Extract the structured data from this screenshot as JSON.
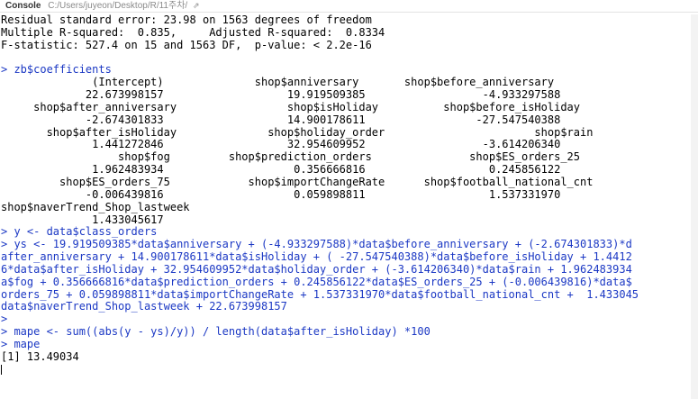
{
  "header": {
    "title": "Console",
    "path": "C:/Users/juyeon/Desktop/R/11주차/",
    "goto_icon": "arrow-right-icon",
    "goto_glyph": "⇗"
  },
  "colors": {
    "command": "#1b38c4",
    "output": "#000000",
    "background": "#ffffff"
  },
  "lines": [
    {
      "kind": "out",
      "text": "Residual standard error: 23.98 on 1563 degrees of freedom"
    },
    {
      "kind": "out",
      "text": "Multiple R-squared:  0.835,\tAdjusted R-squared:  0.8334"
    },
    {
      "kind": "out",
      "text": "F-statistic: 527.4 on 15 and 1563 DF,  p-value: < 2.2e-16"
    },
    {
      "kind": "out",
      "text": ""
    },
    {
      "kind": "cmd",
      "text": "> zb$coefficients"
    },
    {
      "kind": "out",
      "text": "              (Intercept)              shop$anniversary       shop$before_anniversary"
    },
    {
      "kind": "out",
      "text": "             22.673998157                   19.919509385                  -4.933297588"
    },
    {
      "kind": "out",
      "text": "     shop$after_anniversary                 shop$isHoliday          shop$before_isHoliday"
    },
    {
      "kind": "out",
      "text": "             -2.674301833                   14.900178611                 -27.547540388"
    },
    {
      "kind": "out",
      "text": "       shop$after_isHoliday              shop$holiday_order                       shop$rain"
    },
    {
      "kind": "out",
      "text": "              1.441272846                   32.954609952                  -3.614206340"
    },
    {
      "kind": "out",
      "text": "                  shop$fog         shop$prediction_orders               shop$ES_orders_25"
    },
    {
      "kind": "out",
      "text": "              1.962483934                    0.356666816                   0.245856122"
    },
    {
      "kind": "out",
      "text": "         shop$ES_orders_75            shop$importChangeRate      shop$football_national_cnt"
    },
    {
      "kind": "out",
      "text": "             -0.006439816                    0.059898811                   1.537331970"
    },
    {
      "kind": "out",
      "text": "shop$naverTrend_Shop_lastweek"
    },
    {
      "kind": "out",
      "text": "              1.433045617"
    },
    {
      "kind": "cmd",
      "text": "> y <- data$class_orders"
    },
    {
      "kind": "cmd",
      "text": "> ys <- 19.919509385*data$anniversary + (-4.933297588)*data$before_anniversary + (-2.674301833)*d"
    },
    {
      "kind": "cmd",
      "text": "after_anniversary + 14.900178611*data$isHoliday + ( -27.547540388)*data$before_isHoliday + 1.4412"
    },
    {
      "kind": "cmd",
      "text": "6*data$after_isHoliday + 32.954609952*data$holiday_order + (-3.614206340)*data$rain + 1.962483934"
    },
    {
      "kind": "cmd",
      "text": "a$fog + 0.356666816*data$prediction_orders + 0.245856122*data$ES_orders_25 + (-0.006439816)*data$"
    },
    {
      "kind": "cmd",
      "text": "orders_75 + 0.059898811*data$importChangeRate + 1.537331970*data$football_national_cnt +  1.433045"
    },
    {
      "kind": "cmd",
      "text": "data$naverTrend_Shop_lastweek + 22.673998157"
    },
    {
      "kind": "cmd",
      "text": ">"
    },
    {
      "kind": "cmd",
      "text": "> mape <- sum((abs(y - ys)/y)) / length(data$after_isHoliday) *100"
    },
    {
      "kind": "cmd",
      "text": "> mape"
    },
    {
      "kind": "out",
      "text": "[1] 13.49034"
    },
    {
      "kind": "cursor",
      "text": ""
    }
  ]
}
